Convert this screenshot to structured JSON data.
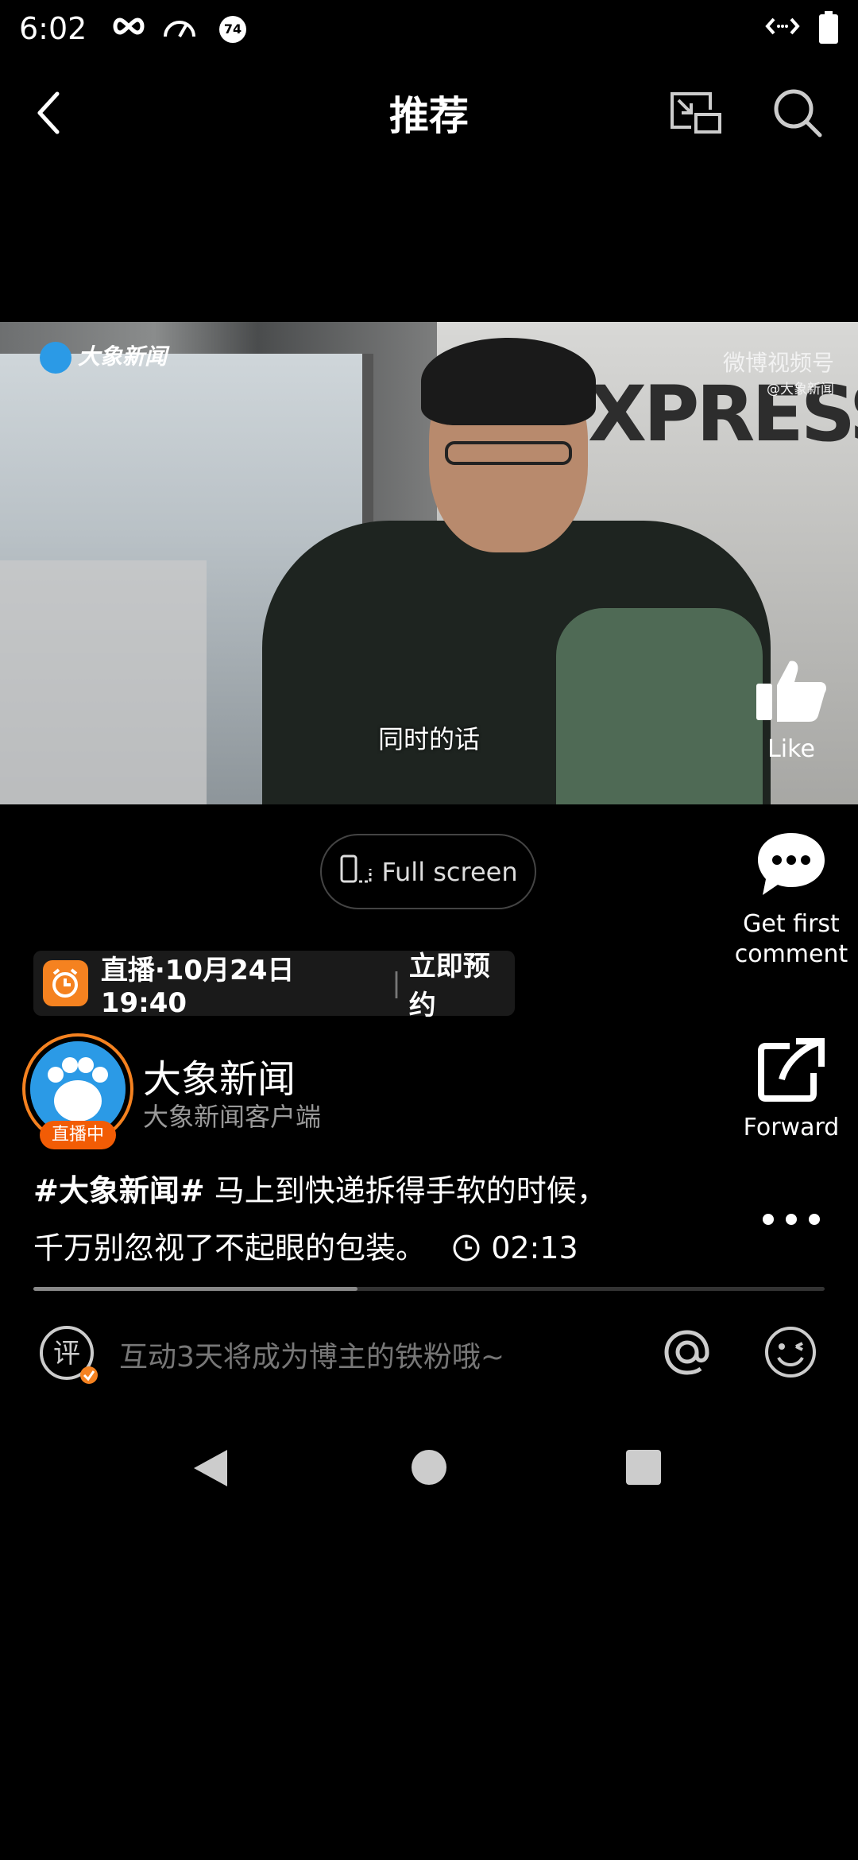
{
  "status_bar": {
    "time": "6:02",
    "icons": [
      "infinity-icon",
      "speedometer-icon",
      "notification-74-icon",
      "code-arrows-icon",
      "battery-icon"
    ],
    "badge_number": "74"
  },
  "header": {
    "title": "推荐",
    "back_icon": "back-arrow-icon",
    "pip_icon": "picture-in-picture-icon",
    "search_icon": "search-icon"
  },
  "video": {
    "watermark_left": "大象新闻",
    "watermark_right": "微博视频号",
    "watermark_right_sub": "@大象新闻",
    "wall_text": "XPRESS",
    "subtitle": "同时的话"
  },
  "actions": {
    "like_label": "Like",
    "comment_label": "Get first comment",
    "forward_label": "Forward",
    "more_icon": "more-dots-icon"
  },
  "fullscreen": {
    "label": "Full screen"
  },
  "live_bar": {
    "schedule": "直播·10月24日 19:40",
    "book": "立即预约"
  },
  "author": {
    "name": "大象新闻",
    "subtitle": "大象新闻客户端",
    "live_badge": "直播中"
  },
  "post": {
    "hashtag": "#大象新闻#",
    "text_line1": " 马上到快递拆得手软的时候，",
    "text_line2": "千万别忽视了不起眼的包装。",
    "duration": "02:13"
  },
  "progress": {
    "played_fraction": 0.41
  },
  "comment": {
    "placeholder": "互动3天将成为博主的铁粉哦~",
    "comment_icon_char": "评"
  },
  "colors": {
    "accent_orange": "#f58220",
    "background": "#000000"
  }
}
